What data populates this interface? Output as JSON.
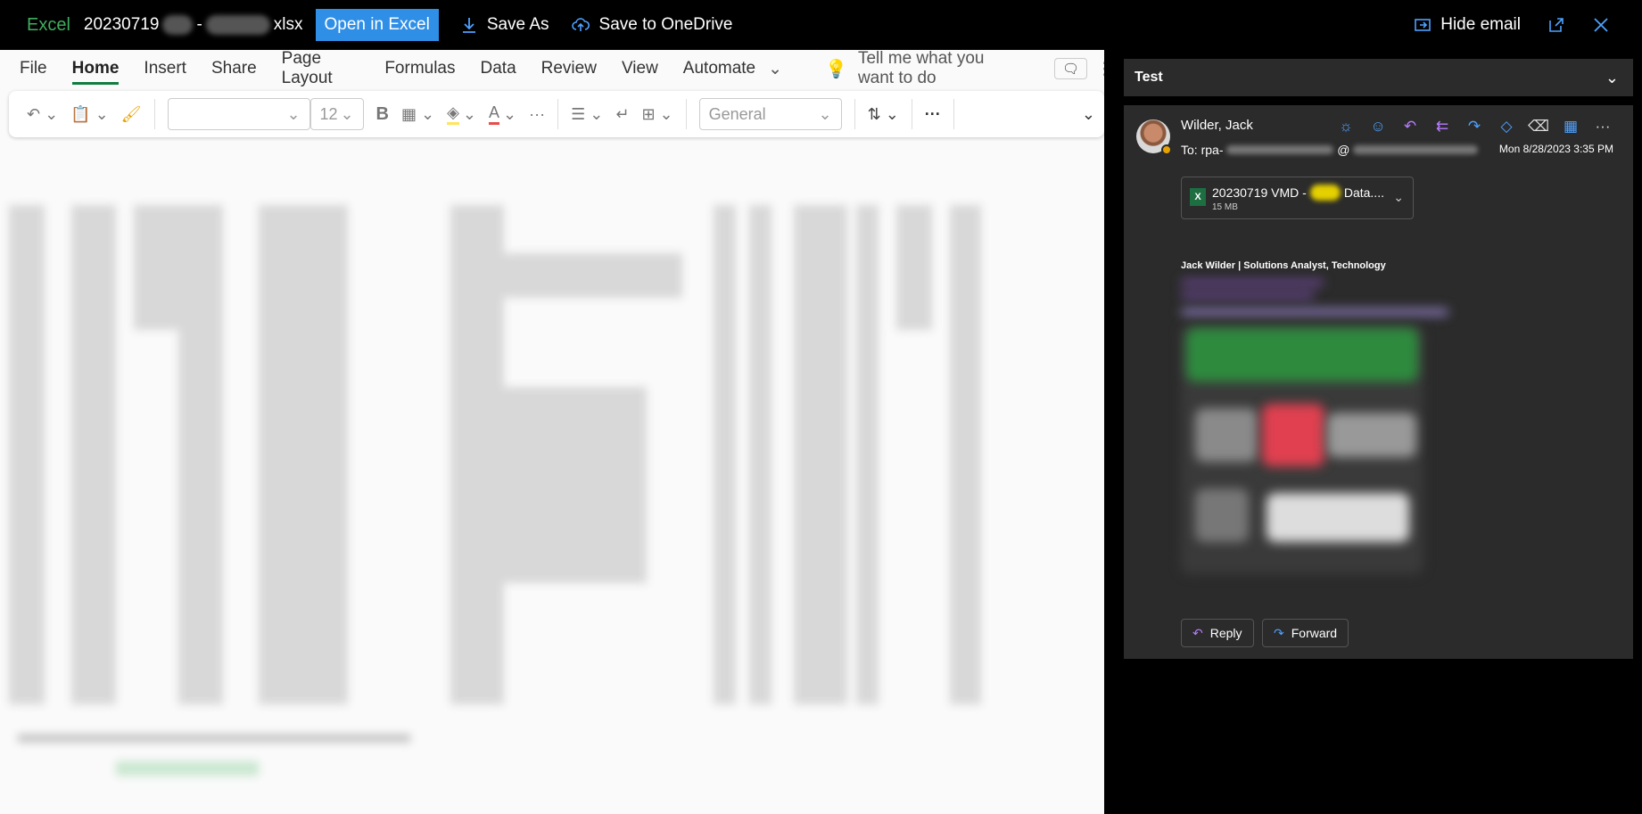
{
  "topbar": {
    "app_name": "Excel",
    "file_prefix": "20230719",
    "file_dash": "-",
    "file_suffix": "xlsx",
    "open_in_excel": "Open in Excel",
    "save_as": "Save As",
    "save_onedrive": "Save to OneDrive",
    "hide_email": "Hide email"
  },
  "menu": {
    "file": "File",
    "home": "Home",
    "insert": "Insert",
    "share": "Share",
    "page_layout": "Page Layout",
    "formulas": "Formulas",
    "data": "Data",
    "review": "Review",
    "view": "View",
    "automate": "Automate",
    "tell_me": "Tell me what you want to do"
  },
  "ribbon": {
    "font_size": "12",
    "bold": "B",
    "number_format": "General",
    "more": "···"
  },
  "email": {
    "header_title": "Test",
    "sender": "Wilder, Jack",
    "to_label": "To:",
    "to_prefix": "rpa-",
    "to_at": "@",
    "date": "Mon 8/28/2023 3:35 PM",
    "attachment_name_start": "20230719 VMD -",
    "attachment_name_end": "Data....",
    "attachment_size": "15 MB",
    "signature": "Jack Wilder | Solutions Analyst, Technology",
    "reply": "Reply",
    "forward": "Forward"
  },
  "colors": {
    "excel_green": "#3fae5e",
    "accent_blue": "#2f8fe6",
    "panel_bg": "#2b2b2b",
    "icon_blue": "#4ea1ff",
    "icon_purple": "#b67cff"
  }
}
